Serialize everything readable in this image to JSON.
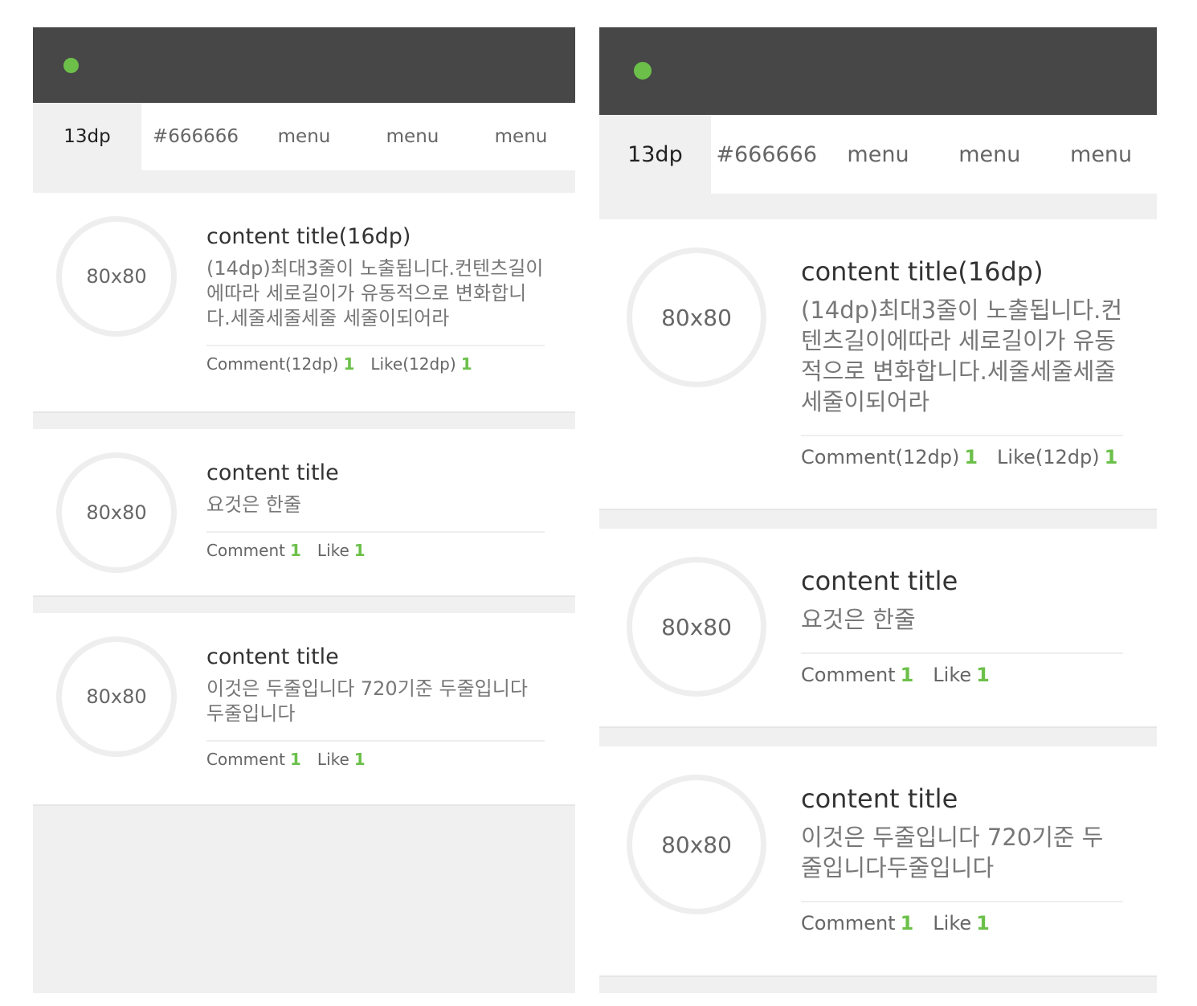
{
  "colors": {
    "appbar": "#474747",
    "accent": "#6cc04a",
    "tab_text": "#666666",
    "background": "#f0f0f0"
  },
  "tabs": [
    "13dp",
    "#666666",
    "menu",
    "menu",
    "menu"
  ],
  "avatar_label": "80x80",
  "left": {
    "items": [
      {
        "title": "content title(16dp)",
        "desc": "(14dp)최대3줄이 노출됩니다.컨텐츠길이에따라 세로길이가 유동적으로 변화합니다.세줄세줄세줄 세줄이되어라",
        "comment_label": "Comment(12dp)",
        "comment_count": "1",
        "like_label": "Like(12dp)",
        "like_count": "1"
      },
      {
        "title": "content title",
        "desc": "요것은 한줄",
        "comment_label": "Comment",
        "comment_count": "1",
        "like_label": "Like",
        "like_count": "1"
      },
      {
        "title": "content title",
        "desc": "이것은 두줄입니다 720기준 두줄입니다두줄입니다",
        "comment_label": "Comment",
        "comment_count": "1",
        "like_label": "Like",
        "like_count": "1"
      }
    ]
  },
  "right": {
    "items": [
      {
        "title": "content title(16dp)",
        "desc": "(14dp)최대3줄이 노출됩니다.컨텐츠길이에따라 세로길이가 유동적으로 변화합니다.세줄세줄세줄 세줄이되어라",
        "comment_label": "Comment(12dp)",
        "comment_count": "1",
        "like_label": "Like(12dp)",
        "like_count": "1"
      },
      {
        "title": "content title",
        "desc": "요것은 한줄",
        "comment_label": "Comment",
        "comment_count": "1",
        "like_label": "Like",
        "like_count": "1"
      },
      {
        "title": "content title",
        "desc": "이것은 두줄입니다 720기준 두줄입니다두줄입니다",
        "comment_label": "Comment",
        "comment_count": "1",
        "like_label": "Like",
        "like_count": "1"
      }
    ]
  }
}
